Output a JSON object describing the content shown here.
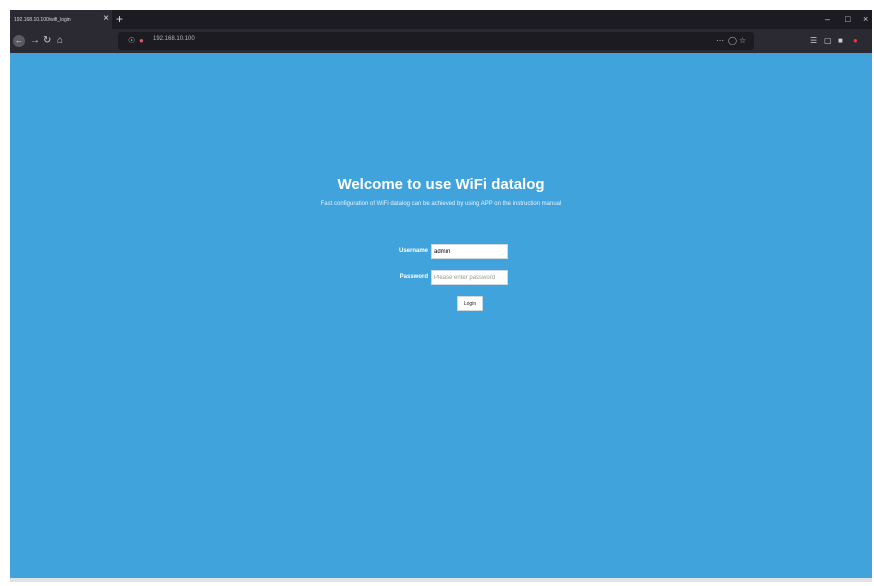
{
  "browser": {
    "tab_title": "192.168.10.100/wifi_login",
    "tab_close": "×",
    "new_tab": "+",
    "url": "192.168.10.100",
    "window_controls": {
      "minimize": "–",
      "maximize": "□",
      "close": "×"
    },
    "nav_icons": [
      "back-icon",
      "forward-icon",
      "reload-icon",
      "home-icon"
    ],
    "url_right_icons": [
      "more-actions-icon",
      "pocket-icon",
      "bookmark-star-icon"
    ],
    "toolbar_right_icons": [
      "library-icon",
      "sidebar-icon",
      "extension-icon",
      "addon-icon"
    ]
  },
  "page": {
    "title": "Welcome to use WiFi datalog",
    "subtitle": "Fast configuration of WiFi datalog can be achieved by using APP on the instruction manual",
    "username_label": "Username",
    "username_value": "admin",
    "password_label": "Password",
    "password_placeholder": "Please enter password",
    "login_label": "Login"
  },
  "colors": {
    "background": "#41a3db",
    "browser_chrome": "#2b2a33",
    "text": "#ffffff"
  }
}
